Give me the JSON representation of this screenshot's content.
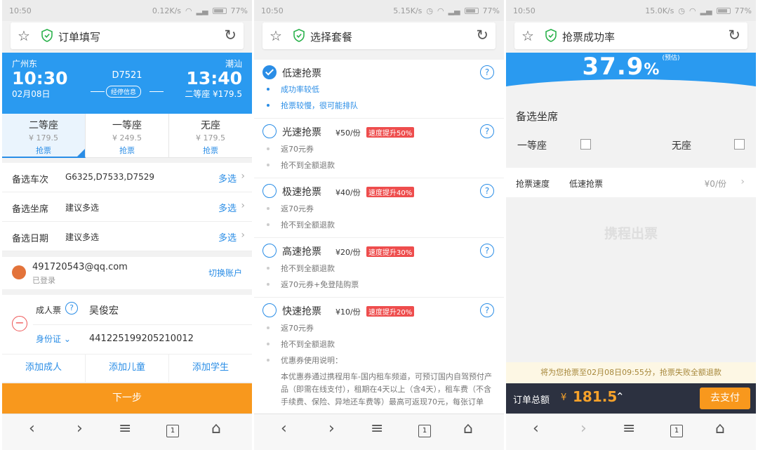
{
  "colors": {
    "accent": "#2a8de6",
    "header_blue": "#2a9af0",
    "orange": "#f8981d",
    "badge_red": "#ee4d4d",
    "paybar": "#2c3140"
  },
  "screens": [
    {
      "status": {
        "time": "10:50",
        "speed": "0.12K/s",
        "battery": "77%"
      },
      "title": "订单填写",
      "train": {
        "from": "广州东",
        "to": "潮汕",
        "dep_time": "10:30",
        "arr_time": "13:40",
        "date": "02月08日",
        "number": "D7521",
        "stops": "经停信息",
        "price_line": "二等座 ¥179.5"
      },
      "seats": [
        {
          "name": "二等座",
          "price": "¥ 179.5",
          "action": "抢票"
        },
        {
          "name": "一等座",
          "price": "¥ 249.5",
          "action": "抢票"
        },
        {
          "name": "无座",
          "price": "¥ 179.5",
          "action": "抢票"
        }
      ],
      "rows": [
        {
          "label": "备选车次",
          "value": "G6325,D7533,D7529",
          "action": "多选"
        },
        {
          "label": "备选坐席",
          "value": "建议多选",
          "action": "多选"
        },
        {
          "label": "备选日期",
          "value": "建议多选",
          "action": "多选"
        }
      ],
      "account": {
        "email": "491720543@qq.com",
        "status": "已登录",
        "switch": "切换账户"
      },
      "passenger": {
        "type": "成人票",
        "name": "吴俊宏",
        "id_type": "身份证",
        "id": "441225199205210012"
      },
      "add": [
        "添加成人",
        "添加儿童",
        "添加学生"
      ],
      "next": "下一步"
    },
    {
      "status": {
        "time": "10:50",
        "speed": "5.15K/s",
        "battery": "77%"
      },
      "title": "选择套餐",
      "packages": [
        {
          "name": "低速抢票",
          "price": "",
          "badge": "",
          "items": [
            "成功率较低",
            "抢票较慢，很可能排队"
          ]
        },
        {
          "name": "光速抢票",
          "price": "¥50/份",
          "badge": "速度提升50%",
          "items": [
            "返70元券",
            "抢不到全额退款"
          ]
        },
        {
          "name": "极速抢票",
          "price": "¥40/份",
          "badge": "速度提升40%",
          "items": [
            "返70元券",
            "抢不到全额退款"
          ]
        },
        {
          "name": "高速抢票",
          "price": "¥20/份",
          "badge": "速度提升30%",
          "items": [
            "抢不到全额退款",
            "返70元券+免登陆购票"
          ]
        },
        {
          "name": "快速抢票",
          "price": "¥10/份",
          "badge": "速度提升20%",
          "items": [
            "返70元券",
            "抢不到全额退款",
            "优惠券使用说明："
          ]
        }
      ],
      "note": "本优惠券通过携程用车-国内租车频道，可预订国内自驾预付产品（即需在线支付），租期在4天以上（含4天），租车费（不含手续费、保险、异地还车费等）最高可返现70元，每张订单"
    },
    {
      "status": {
        "time": "10:50",
        "speed": "15.0K/s",
        "battery": "77%"
      },
      "title": "抢票成功率",
      "rate": {
        "value": "37.9",
        "unit": "%",
        "est": "(预估)"
      },
      "spare": {
        "title": "备选坐席",
        "opt1": "一等座",
        "opt2": "无座"
      },
      "speed": {
        "label": "抢票速度",
        "value": "低速抢票",
        "price": "¥0/份"
      },
      "watermark": "携程出票",
      "notice": "将为您抢票至02月08日09:55分，抢票失败全额退款",
      "pay": {
        "label": "订单总额",
        "currency": "¥",
        "amount": "181.5",
        "button": "去支付"
      }
    }
  ],
  "nav": {
    "tabs": "1"
  }
}
